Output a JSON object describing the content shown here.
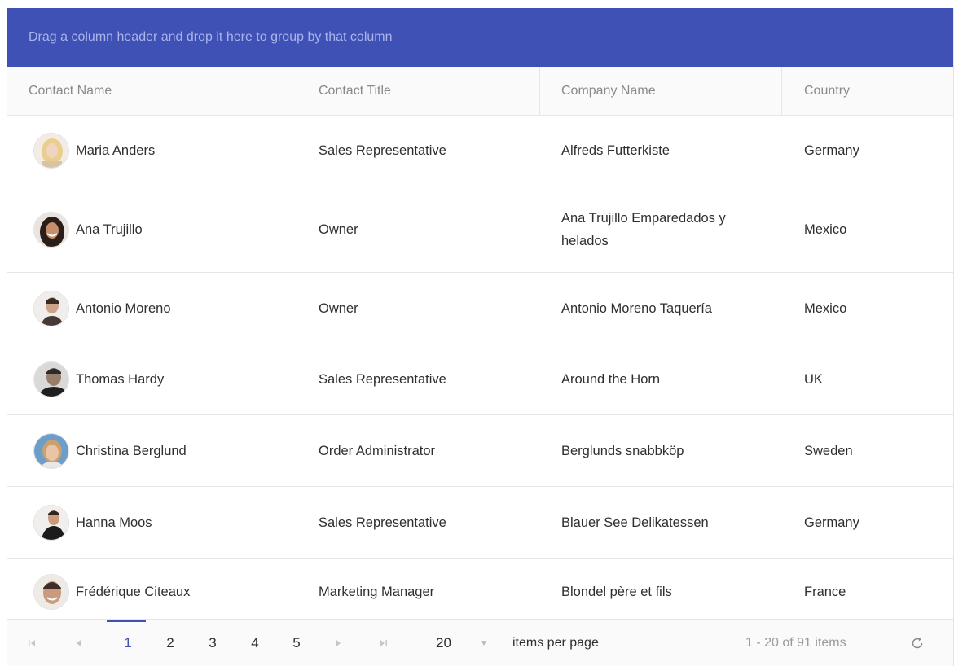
{
  "group_panel": {
    "hint": "Drag a column header and drop it here to group by that column"
  },
  "columns": [
    "Contact Name",
    "Contact Title",
    "Company Name",
    "Country"
  ],
  "rows": [
    {
      "name": "Maria Anders",
      "title": "Sales Representative",
      "company": "Alfreds Futterkiste",
      "country": "Germany",
      "avatar": "avatar-blonde-woman"
    },
    {
      "name": "Ana Trujillo",
      "title": "Owner",
      "company": "Ana Trujillo Emparedados y helados",
      "country": "Mexico",
      "avatar": "avatar-dark-haired-woman"
    },
    {
      "name": "Antonio Moreno",
      "title": "Owner",
      "company": "Antonio Moreno Taquería",
      "country": "Mexico",
      "avatar": "avatar-man"
    },
    {
      "name": "Thomas Hardy",
      "title": "Sales Representative",
      "company": "Around the Horn",
      "country": "UK",
      "avatar": "avatar-man-dark"
    },
    {
      "name": "Christina Berglund",
      "title": "Order Administrator",
      "company": "Berglunds snabbköp",
      "country": "Sweden",
      "avatar": "avatar-woman-blue"
    },
    {
      "name": "Hanna Moos",
      "title": "Sales Representative",
      "company": "Blauer See Delikatessen",
      "country": "Germany",
      "avatar": "avatar-woman-dark"
    },
    {
      "name": "Frédérique Citeaux",
      "title": "Marketing Manager",
      "company": "Blondel père et fils",
      "country": "France",
      "avatar": "avatar-man-smiling"
    }
  ],
  "pager": {
    "first_icon": "first-page-icon",
    "prev_icon": "previous-page-icon",
    "pages": [
      "1",
      "2",
      "3",
      "4",
      "5"
    ],
    "current_page": "1",
    "next_icon": "next-page-icon",
    "last_icon": "last-page-icon",
    "page_size": "20",
    "items_per_page_label": "items per page",
    "info": "1 - 20 of 91 items",
    "refresh_icon": "refresh-icon"
  },
  "colors": {
    "accent": "#3f51b5",
    "header_bg": "#fafafa",
    "border": "#e6e6e6"
  }
}
